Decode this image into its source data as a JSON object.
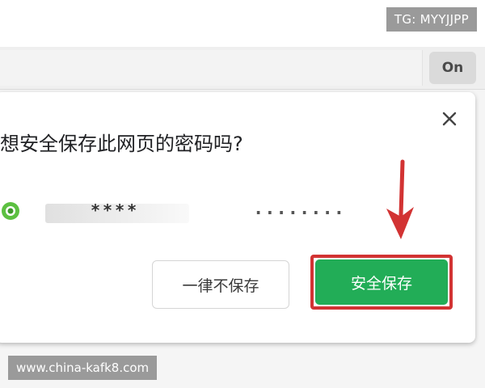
{
  "watermarks": {
    "top": "TG: MYYJJPP",
    "bottom": "www.china-kafk8.com"
  },
  "toolbar": {
    "key_button_label": "On",
    "address_value": ""
  },
  "dialog": {
    "title": "想安全保存此网页的密码吗?",
    "site_icon": "site-favicon-icon",
    "username": "****",
    "password": "........",
    "never_save_label": "一律不保存",
    "save_label": "安全保存",
    "close_icon": "close-icon"
  },
  "colors": {
    "save_button": "#22ad57",
    "highlight_outline": "#d23333",
    "arrow": "#d23333"
  }
}
